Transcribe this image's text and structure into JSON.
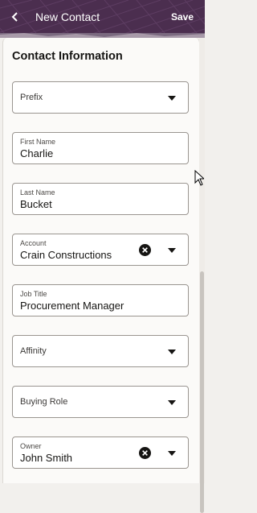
{
  "header": {
    "title": "New Contact",
    "save_label": "Save",
    "back_icon": "chevron-left-icon",
    "background": "#4b2e4f"
  },
  "section": {
    "title": "Contact Information"
  },
  "fields": {
    "prefix": {
      "placeholder": "Prefix"
    },
    "first_name": {
      "label": "First Name",
      "value": "Charlie"
    },
    "last_name": {
      "label": "Last Name",
      "value": "Bucket"
    },
    "account": {
      "label": "Account",
      "value": "Crain Constructions"
    },
    "job_title": {
      "label": "Job Title",
      "value": "Procurement Manager"
    },
    "affinity": {
      "placeholder": "Affinity"
    },
    "buying_role": {
      "placeholder": "Buying Role"
    },
    "owner": {
      "label": "Owner",
      "value": "John Smith"
    }
  },
  "colors": {
    "header": "#4b2e4f",
    "field_border": "#9a9590",
    "text": "#161513"
  }
}
